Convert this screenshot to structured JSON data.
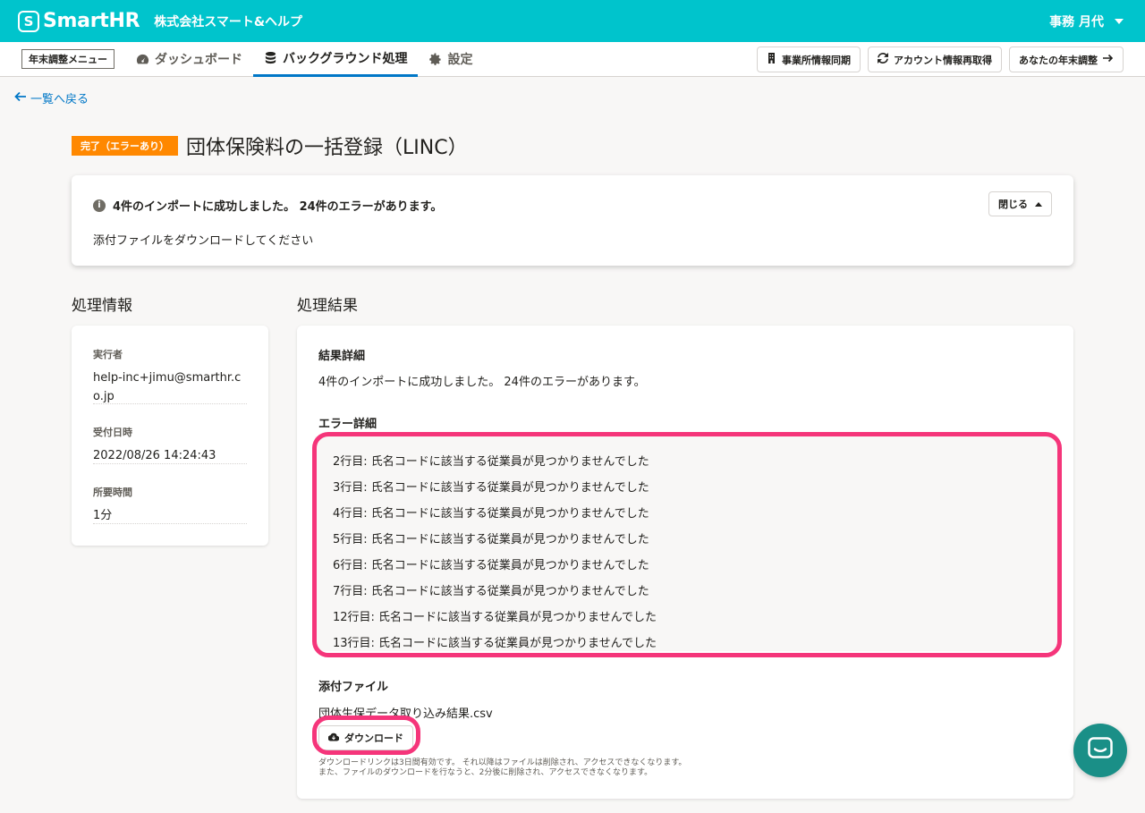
{
  "header": {
    "logo_mark": "S",
    "logo_text": "SmartHR",
    "company": "株式会社スマート&ヘルプ",
    "user": "事務 月代"
  },
  "nav": {
    "menu_tag": "年末調整メニュー",
    "tabs": [
      {
        "label": "ダッシュボード",
        "icon": "dashboard-icon"
      },
      {
        "label": "バックグラウンド処理",
        "icon": "database-icon"
      },
      {
        "label": "設定",
        "icon": "gear-icon"
      }
    ],
    "buttons": [
      {
        "label": "事業所情報同期",
        "icon": "building-icon"
      },
      {
        "label": "アカウント情報再取得",
        "icon": "sync-icon"
      },
      {
        "label": "あなたの年末調整",
        "icon": "arrow-right-icon"
      }
    ]
  },
  "back_link": "一覧へ戻る",
  "title": {
    "status": "完了（エラーあり）",
    "text": "団体保険料の一括登録（LINC）"
  },
  "alert": {
    "message": "4件のインポートに成功しました。 24件のエラーがあります。",
    "body": "添付ファイルをダウンロードしてください",
    "close_label": "閉じる"
  },
  "info_section": {
    "heading": "処理情報",
    "items": [
      {
        "label": "実行者",
        "value": "help-inc+jimu@smarthr.co.jp"
      },
      {
        "label": "受付日時",
        "value": "2022/08/26 14:24:43"
      },
      {
        "label": "所要時間",
        "value": "1分"
      }
    ]
  },
  "result_section": {
    "heading": "処理結果",
    "detail_heading": "結果詳細",
    "detail_text": "4件のインポートに成功しました。 24件のエラーがあります。",
    "error_heading": "エラー詳細",
    "errors": [
      "2行目: 氏名コードに該当する従業員が見つかりませんでした",
      "3行目: 氏名コードに該当する従業員が見つかりませんでした",
      "4行目: 氏名コードに該当する従業員が見つかりませんでした",
      "5行目: 氏名コードに該当する従業員が見つかりませんでした",
      "6行目: 氏名コードに該当する従業員が見つかりませんでした",
      "7行目: 氏名コードに該当する従業員が見つかりませんでした",
      "12行目: 氏名コードに該当する従業員が見つかりませんでした",
      "13行目: 氏名コードに該当する従業員が見つかりませんでした"
    ],
    "attachment_heading": "添付ファイル",
    "file_name": "団体生保データ取り込み結果.csv",
    "download_label": "ダウンロード",
    "note_line1": "ダウンロードリンクは3日間有効です。 それ以降はファイルは削除され、アクセスできなくなります。",
    "note_line2": "また、ファイルのダウンロードを行なうと、2分後に削除され、アクセスできなくなります。"
  },
  "colors": {
    "header": "#00c4cc",
    "accent": "#0077c7",
    "status_badge": "#ff8800",
    "highlight": "#f5357a",
    "chat": "#1a8f87"
  }
}
